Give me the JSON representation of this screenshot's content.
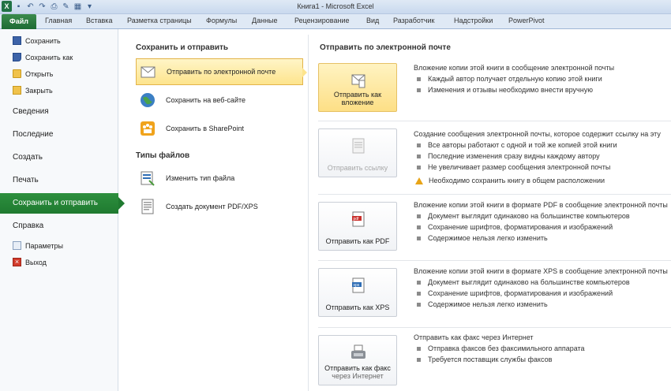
{
  "window": {
    "title": "Книга1  -  Microsoft Excel"
  },
  "qat": {
    "app_icon": "X"
  },
  "ribbon_tabs": [
    "Файл",
    "Главная",
    "Вставка",
    "Разметка страницы",
    "Формулы",
    "Данные",
    "Рецензирование",
    "Вид",
    "Разработчик",
    "Надстройки",
    "PowerPivot"
  ],
  "nav": {
    "save": "Сохранить",
    "save_as": "Сохранить как",
    "open": "Открыть",
    "close": "Закрыть",
    "info": "Сведения",
    "recent": "Последние",
    "new": "Создать",
    "print": "Печать",
    "share": "Сохранить и отправить",
    "help": "Справка",
    "options": "Параметры",
    "exit": "Выход"
  },
  "middle": {
    "section1_title": "Сохранить и отправить",
    "items1": [
      "Отправить по электронной почте",
      "Сохранить на веб-сайте",
      "Сохранить в SharePoint"
    ],
    "section2_title": "Типы файлов",
    "items2": [
      "Изменить тип файла",
      "Создать документ PDF/XPS"
    ]
  },
  "right": {
    "title": "Отправить по электронной почте",
    "attach": {
      "button": "Отправить как вложение",
      "desc": "Вложение копии этой книги в сообщение электронной почты",
      "bullets": [
        "Каждый автор получает отдельную копию этой книги",
        "Изменения и отзывы необходимо внести вручную"
      ]
    },
    "link": {
      "button": "Отправить ссылку",
      "desc": "Создание сообщения электронной почты, которое содержит ссылку на эту",
      "bullets": [
        "Все авторы работают с одной и той же копией этой книги",
        "Последние изменения сразу видны каждому автору",
        "Не увеличивает размер сообщения электронной почты"
      ],
      "warning": "Необходимо сохранить книгу в общем расположении"
    },
    "pdf": {
      "button": "Отправить как PDF",
      "desc": "Вложение копии этой книги в формате PDF в сообщение электронной почты",
      "bullets": [
        "Документ выглядит одинаково на большинстве компьютеров",
        "Сохранение шрифтов, форматирования и изображений",
        "Содержимое нельзя легко изменить"
      ]
    },
    "xps": {
      "button": "Отправить как XPS",
      "desc": "Вложение копии этой книги в формате XPS в сообщение электронной почты",
      "bullets": [
        "Документ выглядит одинаково на большинстве компьютеров",
        "Сохранение шрифтов, форматирования и изображений",
        "Содержимое нельзя легко изменить"
      ]
    },
    "fax": {
      "button_line1": "Отправить как факс",
      "button_line2": "через Интернет",
      "desc": "Отправить как факс через Интернет",
      "bullets": [
        "Отправка факсов без факсимильного аппарата",
        "Требуется поставщик службы факсов"
      ]
    }
  },
  "colors": {
    "accent_green": "#1f7a30",
    "highlight_yellow": "#fde48d"
  }
}
